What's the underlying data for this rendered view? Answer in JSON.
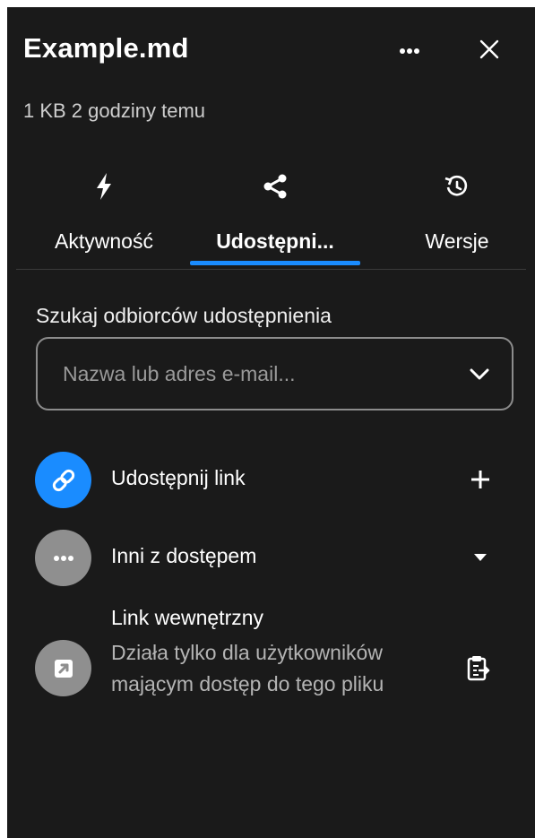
{
  "header": {
    "title": "Example.md",
    "meta": "1 KB 2 godziny temu"
  },
  "tabs": [
    {
      "label": "Aktywność",
      "icon": "activity-icon"
    },
    {
      "label": "Udostępni...",
      "icon": "share-icon",
      "active": true
    },
    {
      "label": "Wersje",
      "icon": "history-icon"
    }
  ],
  "sharing": {
    "search_label": "Szukaj odbiorców udostępnienia",
    "search_placeholder": "Nazwa lub adres e-mail...",
    "share_link_label": "Udostępnij link",
    "others_label": "Inni z dostępem",
    "internal_link_title": "Link wewnętrzny",
    "internal_link_desc": "Działa tylko dla użytkowników mającym dostęp do tego pliku"
  },
  "colors": {
    "accent": "#1a8cff",
    "panel_bg": "#1a1a1a",
    "avatar_gray": "#8f8f8f"
  }
}
